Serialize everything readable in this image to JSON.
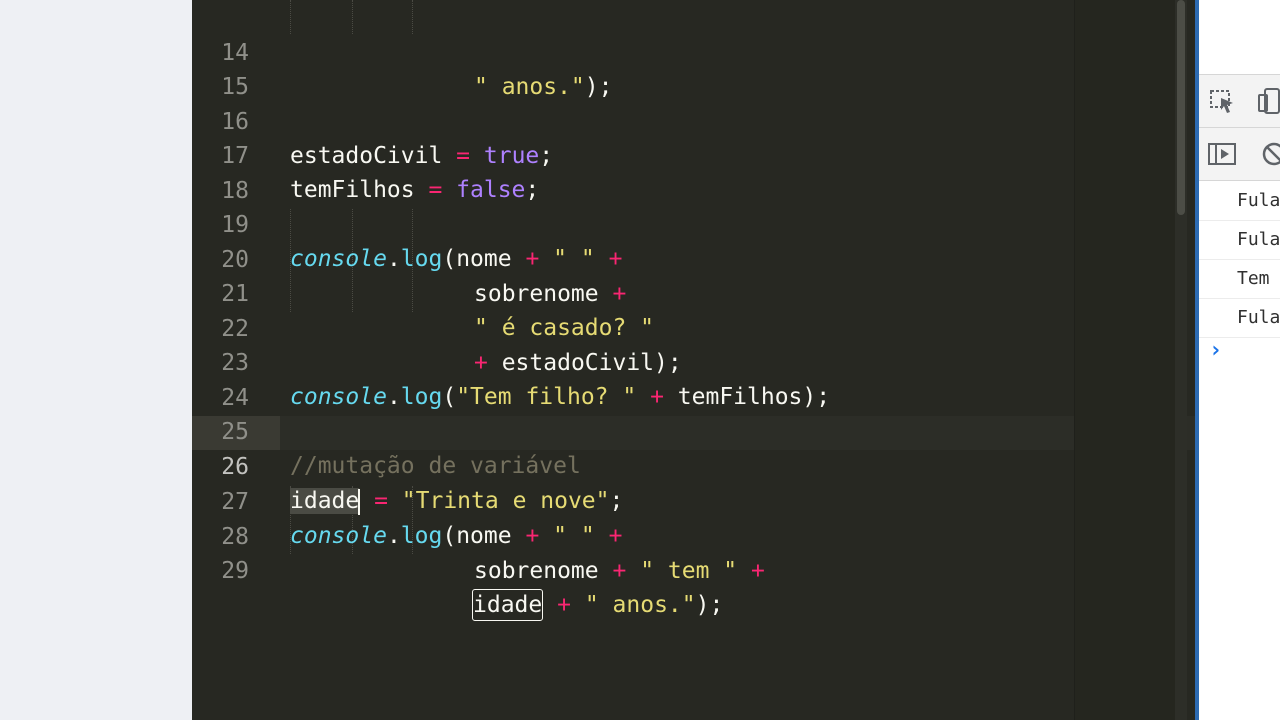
{
  "editor": {
    "lines": [
      {
        "num": "14"
      },
      {
        "num": "15"
      },
      {
        "num": "16"
      },
      {
        "num": "17"
      },
      {
        "num": "18"
      },
      {
        "num": "19"
      },
      {
        "num": "20"
      },
      {
        "num": "21"
      },
      {
        "num": "22"
      },
      {
        "num": "23"
      },
      {
        "num": "24"
      },
      {
        "num": "25"
      },
      {
        "num": "26"
      },
      {
        "num": "27"
      },
      {
        "num": "28"
      },
      {
        "num": "29"
      }
    ],
    "tokens": {
      "l14_str": "\" anos.\"",
      "l14_end": ");",
      "l16_id": "estadoCivil",
      "l16_eq": " = ",
      "l16_val": "true",
      "l16_end": ";",
      "l17_id": "temFilhos",
      "l17_eq": " = ",
      "l17_val": "false",
      "l17_end": ";",
      "console": "console",
      "dot": ".",
      "log": "log",
      "l19_args": "(nome ",
      "plus": "+",
      "space_str": "\" \"",
      "l20_id": "sobrenome ",
      "l21_str": "\" é casado? \"",
      "l22_id": " estadoCivil);",
      "l23_open": "(",
      "l23_str": "\"Tem filho? \"",
      "l23_id": " temFilhos);",
      "l25_comment": "//mutação de variável",
      "l26_id": "idade",
      "l26_eq": " = ",
      "l26_str": "\"Trinta e nove\"",
      "l26_end": ";",
      "l27_args": "(nome ",
      "l28_id": "sobrenome ",
      "l28_str": "\" tem \"",
      "l29_id": "idade",
      "l29_str": "\" anos.\"",
      "l29_end": ");"
    }
  },
  "devtools": {
    "console_rows": [
      "Fula",
      "Fula",
      "Tem ",
      "Fula"
    ],
    "prompt": "›"
  },
  "colors": {
    "editor_bg": "#272822",
    "keyword": "#ae81ff",
    "operator": "#f92672",
    "string": "#e6db74",
    "comment": "#75715e",
    "builtin": "#66d9ef"
  },
  "icons": [
    "inspect-element-icon",
    "device-toolbar-icon",
    "sidebar-toggle-icon",
    "clear-console-icon"
  ]
}
